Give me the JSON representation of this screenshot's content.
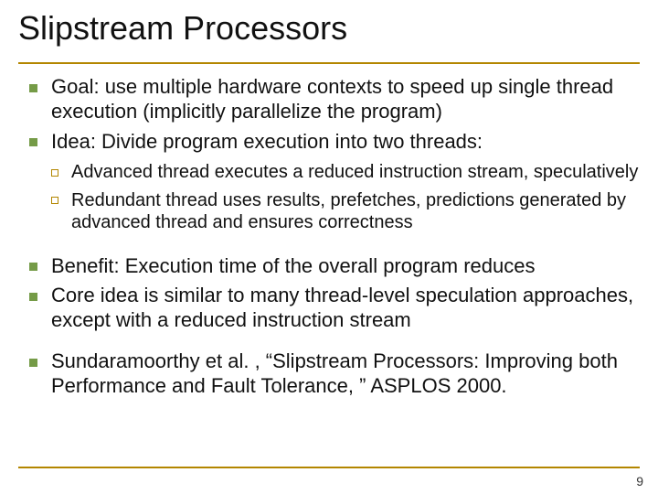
{
  "title": "Slipstream Processors",
  "bullets_a": [
    "Goal: use multiple hardware contexts to speed up single thread execution (implicitly parallelize the program)",
    "Idea: Divide program execution into two threads:"
  ],
  "sub_bullets": [
    "Advanced thread executes a reduced instruction stream, speculatively",
    "Redundant thread uses results, prefetches, predictions generated by advanced thread and ensures correctness"
  ],
  "bullets_b": [
    "Benefit: Execution time of the overall program reduces",
    "Core idea is similar to many thread-level speculation approaches, except with a reduced instruction stream"
  ],
  "bullets_c": [
    "Sundaramoorthy et al. , “Slipstream Processors: Improving both Performance and Fault Tolerance, ” ASPLOS 2000."
  ],
  "page_number": "9"
}
